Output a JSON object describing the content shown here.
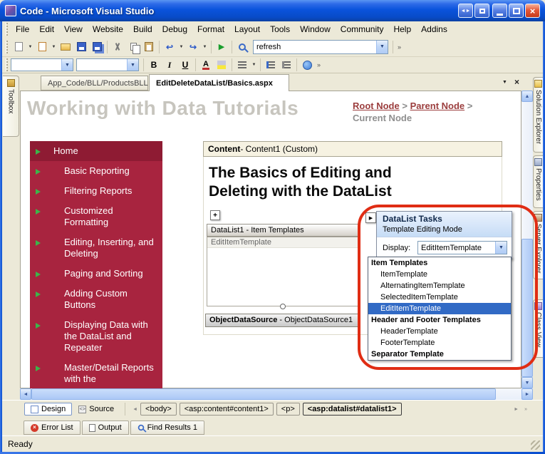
{
  "window": {
    "title": "Code - Microsoft Visual Studio"
  },
  "menu": {
    "items": [
      "File",
      "Edit",
      "View",
      "Website",
      "Build",
      "Debug",
      "Format",
      "Layout",
      "Tools",
      "Window",
      "Community",
      "Help",
      "Addins"
    ]
  },
  "toolbar": {
    "find_value": "refresh"
  },
  "format_toolbar": {
    "bold": "B",
    "italic": "I",
    "underline": "U",
    "font_color": "A"
  },
  "doc_tabs": {
    "tab1": "App_Code/BLL/ProductsBLL",
    "tab2": "EditDeleteDataList/Basics.aspx"
  },
  "left_dock": {
    "toolbox": "Toolbox"
  },
  "right_dock": {
    "tab1": "Solution Explorer",
    "tab2": "Properties",
    "tab3": "Server Explorer",
    "tab4": "Class View"
  },
  "page": {
    "title": "Working with Data Tutorials",
    "breadcrumb": {
      "root": "Root Node",
      "sep": ">",
      "parent": "Parent Node",
      "current": "Current Node"
    },
    "nav": [
      "Home",
      "Basic Reporting",
      "Filtering Reports",
      "Customized Formatting",
      "Editing, Inserting, and Deleting",
      "Paging and Sorting",
      "Adding Custom Buttons",
      "Displaying Data with the DataList and Repeater",
      "Master/Detail Reports with the"
    ],
    "content_header": {
      "bold": "Content",
      "rest": " - Content1 (Custom)"
    },
    "article_title": "The Basics of Editing and Deleting with the DataList",
    "datalist_header": "DataList1 - Item Templates",
    "template_label": "EditItemTemplate",
    "datasource": {
      "bold": "ObjectDataSource",
      "rest": " - ObjectDataSource1"
    }
  },
  "tasks_popup": {
    "title": "DataList Tasks",
    "subtitle": "Template Editing Mode",
    "display_label": "Display:",
    "display_value": "EditItemTemplate",
    "groups": [
      {
        "header": "Item Templates",
        "items": [
          "ItemTemplate",
          "AlternatingItemTemplate",
          "SelectedItemTemplate",
          "EditItemTemplate"
        ],
        "selected": "EditItemTemplate"
      },
      {
        "header": "Header and Footer Templates",
        "items": [
          "HeaderTemplate",
          "FooterTemplate"
        ]
      },
      {
        "header": "Separator Template",
        "items": []
      }
    ]
  },
  "view_bar": {
    "design": "Design",
    "source": "Source",
    "tags": [
      "<body>",
      "<asp:content#content1>",
      "<p>",
      "<asp:datalist#datalist1>"
    ],
    "active_tag": "<asp:datalist#datalist1>"
  },
  "bottom_tabs": {
    "tab1": "Error List",
    "tab2": "Output",
    "tab3": "Find Results 1"
  },
  "status": {
    "text": "Ready"
  },
  "colors": {
    "nav_red": "#A8243F",
    "nav_red_dark": "#8E1B33",
    "selection_blue": "#316AC5",
    "annotation_red": "#E02D14",
    "titlebar_blue": "#0A53DC"
  },
  "glyphs": {
    "dropdown": "▼",
    "up": "▲",
    "down": "▼",
    "left": "◄",
    "right": "►",
    "play": "▶",
    "close": "×",
    "overflow": "»",
    "smart_tag": "▶",
    "move_handle": "+",
    "left_right": "◄►",
    "undo": "↩",
    "redo": "↪",
    "source_mark": "<>"
  }
}
